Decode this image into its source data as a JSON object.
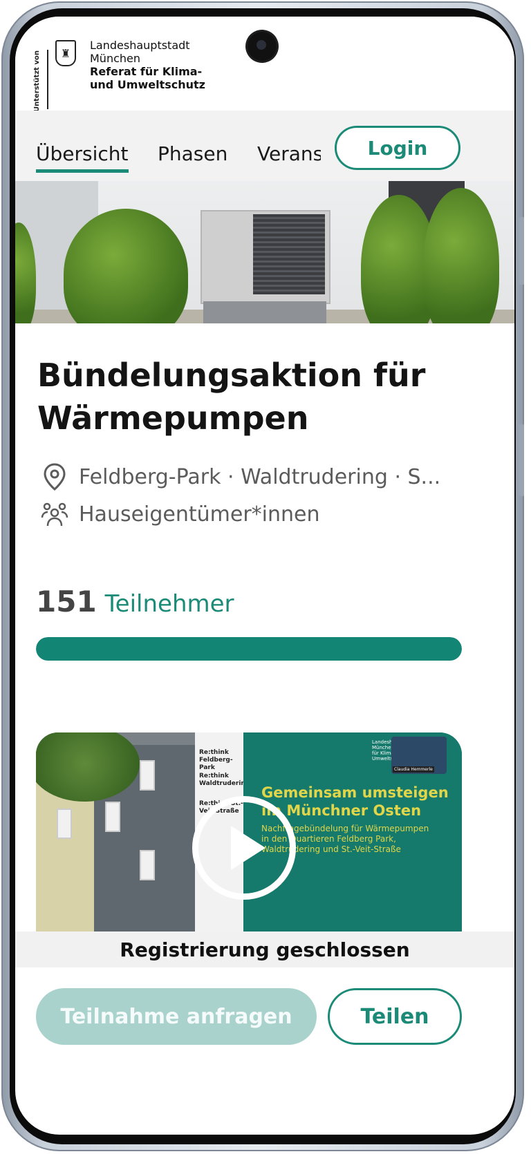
{
  "header": {
    "supported_by": "Unterstützt von",
    "org_line1": "Landeshauptstadt",
    "org_line2": "München",
    "org_line3": "Referat für Klima-",
    "org_line4": "und Umweltschutz"
  },
  "nav": {
    "tabs": [
      {
        "label": "Übersicht",
        "active": true
      },
      {
        "label": "Phasen",
        "active": false
      },
      {
        "label": "Veranstaltungen",
        "active": false
      }
    ],
    "login_label": "Login"
  },
  "main": {
    "title": "Bündelungsaktion für Wärmepumpen",
    "location": "Feldberg-Park · Waldtrudering · S...",
    "audience": "Hauseigentümer*innen",
    "participants_count": "151",
    "participants_label": "Teilnehmer",
    "progress_fraction": 1.0
  },
  "video": {
    "strip_items": [
      "Re:think Feldberg-Park",
      "Re:think Waldtrudering",
      "Re:think St.-Veit-Straße"
    ],
    "slide_heading": "Gemeinsam umsteigen im Münchner Osten",
    "slide_subtext": "Nachfragebündelung für Wärmepumpen in den Quartieren Feldberg Park, Waldtrudering und St.-Veit-Straße",
    "speaker_name": "Claudia Hemmerle",
    "slide_org": "Landeshauptstadt München Referat für Klima- und Umweltschutz"
  },
  "status": {
    "registration_closed": "Registrierung geschlossen"
  },
  "actions": {
    "request_label": "Teilnahme anfragen",
    "share_label": "Teilen"
  },
  "colors": {
    "accent": "#1b8a77",
    "progress": "#138574",
    "disabled_button": "#a9d2cc"
  }
}
